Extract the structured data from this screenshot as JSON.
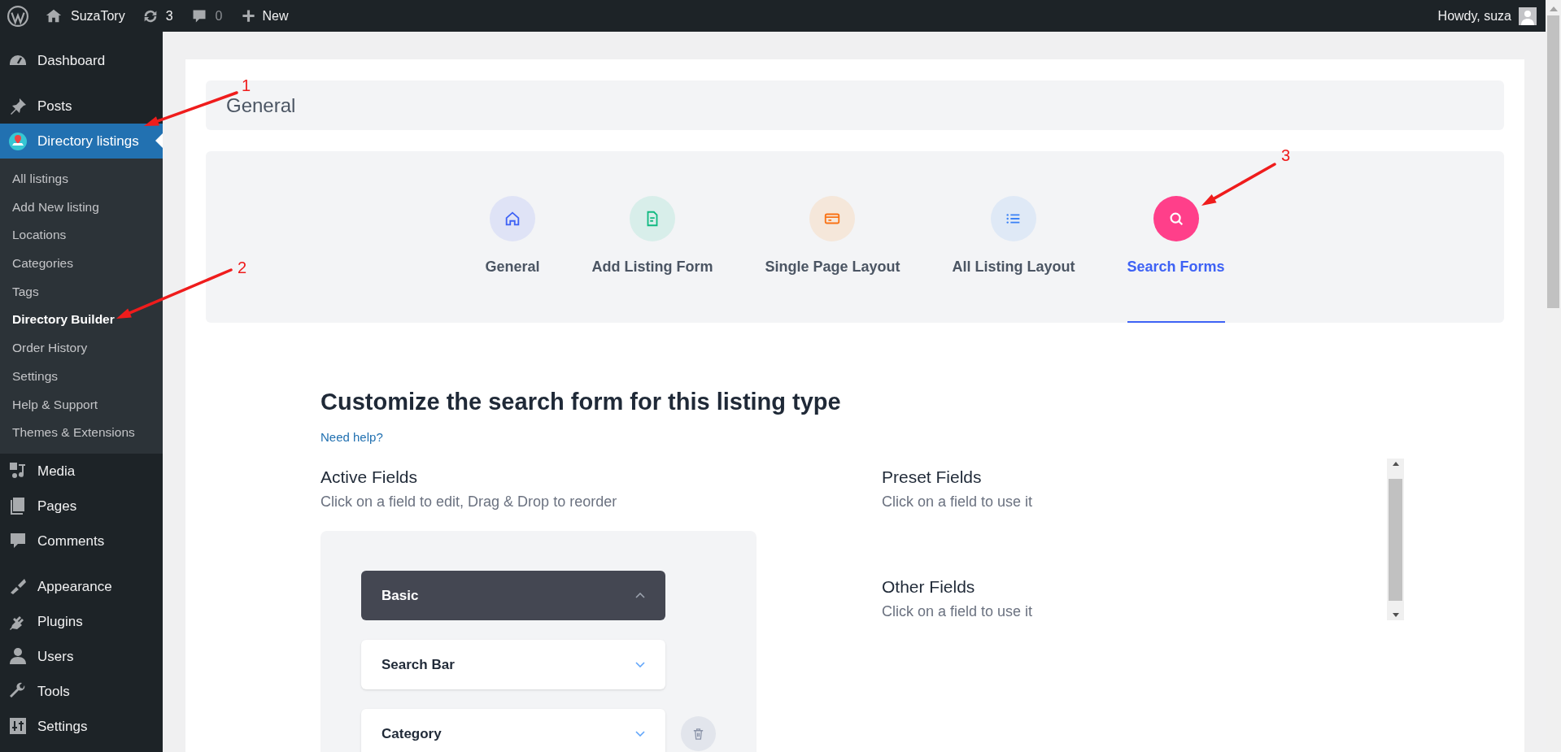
{
  "admin_bar": {
    "site": "SuzaTory",
    "updates": "3",
    "comments": "0",
    "new": "New",
    "greeting": "Howdy, suza"
  },
  "sidebar": {
    "groups": [
      [
        {
          "label": "Dashboard",
          "selected": false
        }
      ],
      [
        {
          "label": "Posts",
          "selected": false
        },
        {
          "label": "Directory listings",
          "selected": true,
          "children": [
            {
              "label": "All listings",
              "selected": false
            },
            {
              "label": "Add New listing",
              "selected": false
            },
            {
              "label": "Locations",
              "selected": false
            },
            {
              "label": "Categories",
              "selected": false
            },
            {
              "label": "Tags",
              "selected": false
            },
            {
              "label": "Directory Builder",
              "selected": true
            },
            {
              "label": "Order History",
              "selected": false
            },
            {
              "label": "Settings",
              "selected": false
            },
            {
              "label": "Help & Support",
              "selected": false
            },
            {
              "label": "Themes & Extensions",
              "selected": false
            }
          ]
        },
        {
          "label": "Media",
          "selected": false
        },
        {
          "label": "Pages",
          "selected": false
        },
        {
          "label": "Comments",
          "selected": false
        }
      ],
      [
        {
          "label": "Appearance",
          "selected": false
        },
        {
          "label": "Plugins",
          "selected": false
        },
        {
          "label": "Users",
          "selected": false
        },
        {
          "label": "Tools",
          "selected": false
        },
        {
          "label": "Settings",
          "selected": false
        }
      ]
    ]
  },
  "header": {
    "title": "General"
  },
  "tabs": [
    {
      "label": "General",
      "selected": false
    },
    {
      "label": "Add Listing Form",
      "selected": false
    },
    {
      "label": "Single Page Layout",
      "selected": false
    },
    {
      "label": "All Listing Layout",
      "selected": false
    },
    {
      "label": "Search Forms",
      "selected": true
    }
  ],
  "content": {
    "title": "Customize the search form for this listing type",
    "help_link": "Need help?",
    "active_fields": {
      "title": "Active Fields",
      "subtitle": "Click on a field to edit, Drag & Drop to reorder",
      "items": [
        {
          "kind": "section",
          "label": "Basic",
          "expanded": true,
          "removable": false
        },
        {
          "kind": "field",
          "label": "Search Bar",
          "expanded": false,
          "removable": false
        },
        {
          "kind": "field",
          "label": "Category",
          "expanded": false,
          "removable": true
        }
      ]
    },
    "preset_fields": {
      "title": "Preset Fields",
      "subtitle": "Click on a field to use it"
    },
    "other_fields": {
      "title": "Other Fields",
      "subtitle": "Click on a field to use it"
    }
  },
  "annotations": [
    {
      "label": "1"
    },
    {
      "label": "2"
    },
    {
      "label": "3"
    }
  ]
}
